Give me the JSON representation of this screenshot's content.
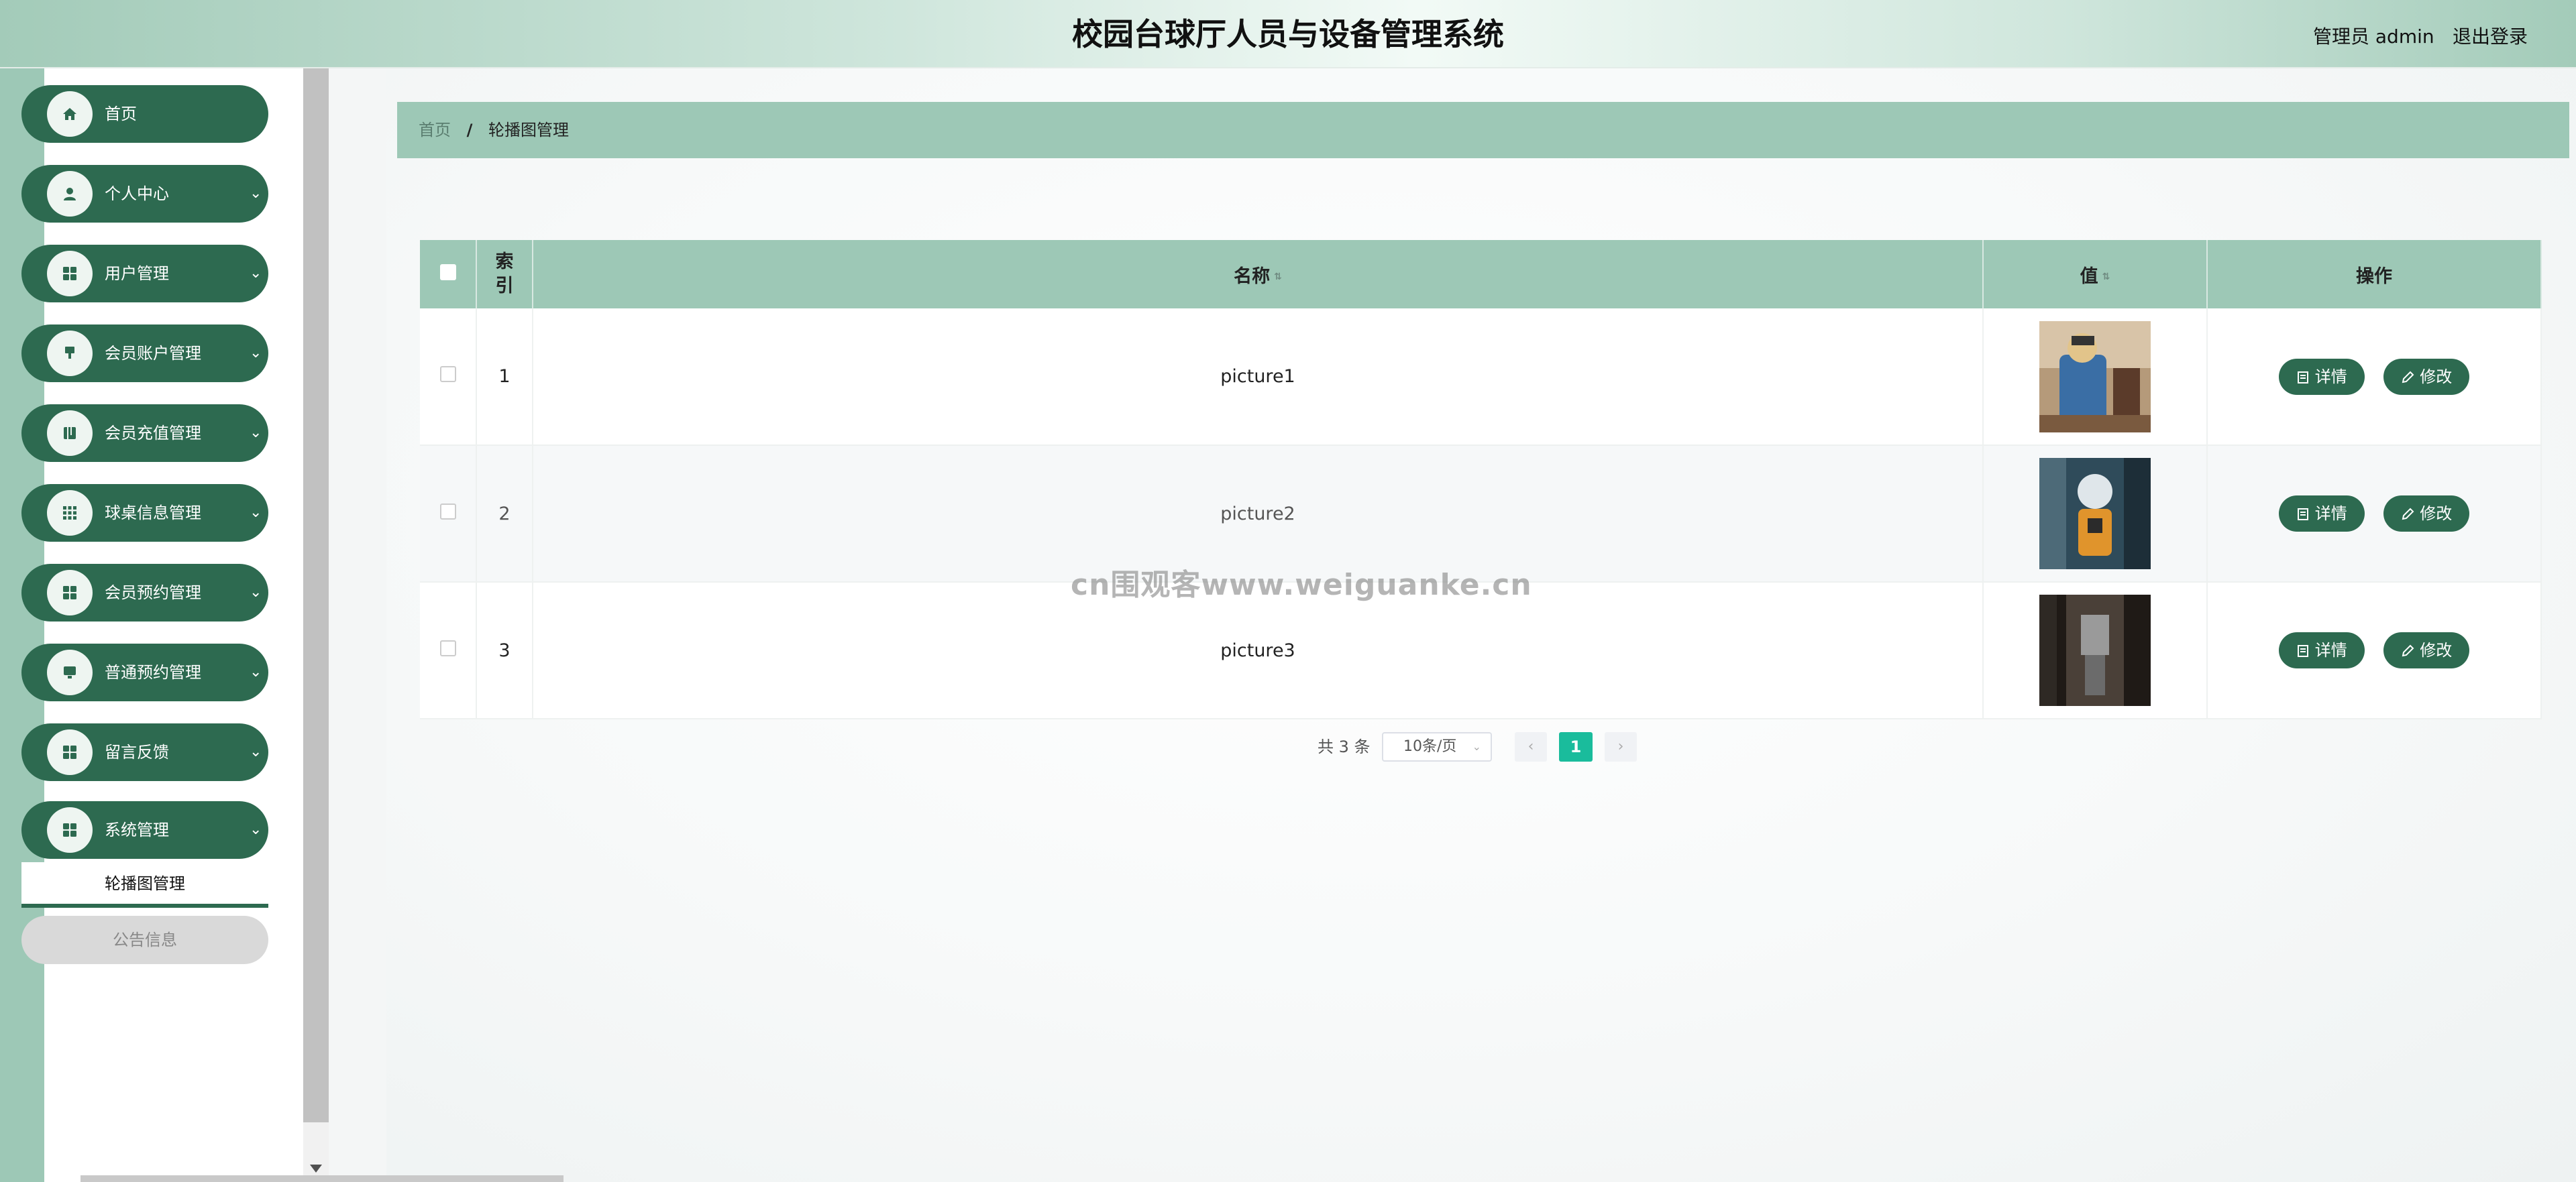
{
  "header": {
    "title": "校园台球厅人员与设备管理系统",
    "user": "管理员 admin",
    "logout": "退出登录"
  },
  "sidebar": {
    "items": [
      {
        "label": "首页",
        "icon": "home-icon",
        "has_submenu": false
      },
      {
        "label": "个人中心",
        "icon": "user-icon",
        "has_submenu": true
      },
      {
        "label": "用户管理",
        "icon": "grid-icon",
        "has_submenu": true
      },
      {
        "label": "会员账户管理",
        "icon": "pin-icon",
        "has_submenu": true
      },
      {
        "label": "会员充值管理",
        "icon": "book-icon",
        "has_submenu": true
      },
      {
        "label": "球桌信息管理",
        "icon": "dots-grid-icon",
        "has_submenu": true
      },
      {
        "label": "会员预约管理",
        "icon": "grid-icon",
        "has_submenu": true
      },
      {
        "label": "普通预约管理",
        "icon": "screen-icon",
        "has_submenu": true
      },
      {
        "label": "留言反馈",
        "icon": "grid-icon",
        "has_submenu": true
      },
      {
        "label": "系统管理",
        "icon": "grid-icon",
        "has_submenu": true
      }
    ],
    "submenu": {
      "active": "轮播图管理",
      "other": "公告信息"
    }
  },
  "breadcrumb": {
    "home": "首页",
    "separator": "/",
    "current": "轮播图管理"
  },
  "table": {
    "columns": {
      "index": "索引",
      "name": "名称",
      "value": "值",
      "actions": "操作"
    },
    "rows": [
      {
        "index": "1",
        "name": "picture1",
        "image": "picture1-thumbnail"
      },
      {
        "index": "2",
        "name": "picture2",
        "image": "picture2-thumbnail"
      },
      {
        "index": "3",
        "name": "picture3",
        "image": "picture3-thumbnail"
      }
    ],
    "actions": {
      "detail": "详情",
      "edit": "修改"
    }
  },
  "pagination": {
    "total": "共 3 条",
    "page_size": "10条/页",
    "prev": "‹",
    "next": "›",
    "current_page": "1"
  },
  "watermark": "cn围观客www.weiguanke.cn",
  "colors": {
    "primary": "#2d6a50",
    "accent": "#9dc8b6",
    "page_active": "#1abc9c"
  }
}
